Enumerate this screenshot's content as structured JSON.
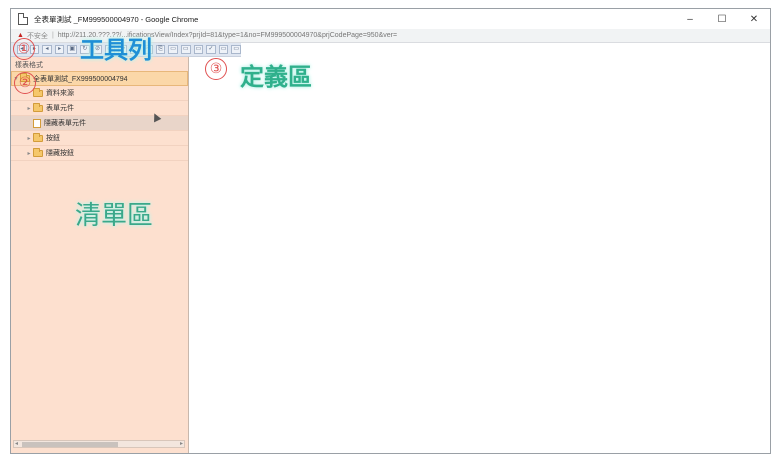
{
  "window": {
    "title": "全表單測試 _FM999500004970 - Google Chrome",
    "controls": {
      "minimize": "–",
      "maximize": "☐",
      "close": "✕"
    }
  },
  "addressbar": {
    "warning": "▲",
    "insecure": "不安全",
    "url": "http://211.20.???.??/...ificationsView/Index?prjId=81&type=1&no=FM999500004970&prjCodePage=950&ver="
  },
  "toolbar": {
    "buttons": [
      "◂",
      "▸",
      "◂",
      "▸",
      "▣",
      "↻",
      "⊘",
      "▭",
      "✚",
      "✎",
      "✂",
      "⎘",
      "▭",
      "▭",
      "▭",
      "✓",
      "▭",
      "▭"
    ]
  },
  "listpanel": {
    "title": "樣表格式",
    "tree": [
      {
        "label": "全表單測試_FX999500004794",
        "type": "root",
        "caret": "▾",
        "icon": "folder-icon"
      },
      {
        "label": "資料來源",
        "type": "folder",
        "caret": "",
        "icon": "folder-icon"
      },
      {
        "label": "表單元件",
        "type": "folder",
        "caret": "▸",
        "icon": "folder-icon"
      },
      {
        "label": "隱藏表單元件",
        "type": "doc",
        "caret": "",
        "icon": "doc-icon"
      },
      {
        "label": "按鈕",
        "type": "folder",
        "caret": "▸",
        "icon": "folder-icon"
      },
      {
        "label": "隱藏按鈕",
        "type": "folder",
        "caret": "▸",
        "icon": "folder-icon"
      }
    ]
  },
  "annotations": {
    "n1": "①",
    "n2": "②",
    "n3": "③",
    "toolbar_label": "工具列",
    "list_label": "清單區",
    "def_label": "定義區"
  },
  "colors": {
    "list_bg": "#fde0cf",
    "root_row": "#fbd7a8",
    "annotation_red": "#e05050",
    "label_blue": "#1f8fd6",
    "label_green": "#2fb08c"
  }
}
